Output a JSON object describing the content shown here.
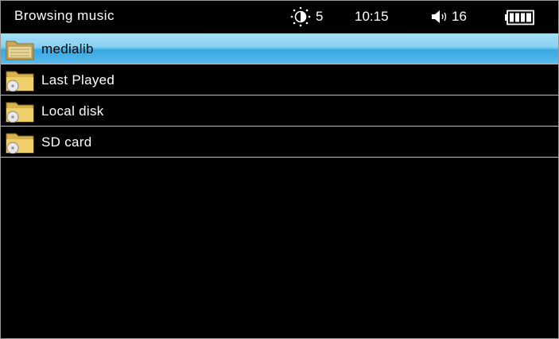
{
  "header": {
    "title": "Browsing music",
    "brightness_icon": "brightness-icon",
    "brightness_value": "5",
    "time": "10:15",
    "volume_icon": "speaker-icon",
    "volume_value": "16",
    "battery_icon": "battery-full-icon"
  },
  "list": {
    "items": [
      {
        "label": "medialib",
        "icon": "folder-icon",
        "selected": true
      },
      {
        "label": "Last Played",
        "icon": "folder-disc-icon",
        "selected": false
      },
      {
        "label": "Local disk",
        "icon": "folder-disc-icon",
        "selected": false
      },
      {
        "label": "SD card",
        "icon": "folder-disc-icon",
        "selected": false
      }
    ]
  },
  "colors": {
    "background": "#000000",
    "selection": "#4fb4e8",
    "divider": "#bdbdbd",
    "text": "#ffffff"
  }
}
